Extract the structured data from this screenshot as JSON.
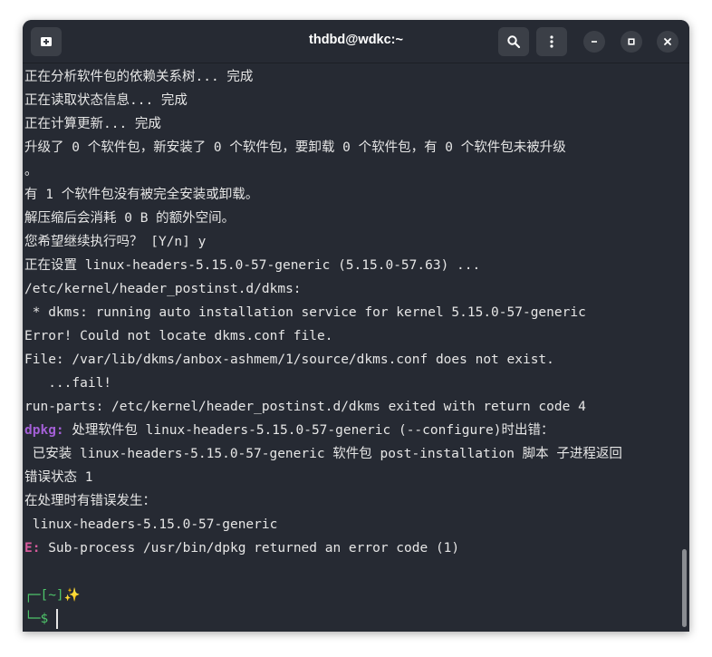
{
  "window": {
    "title": "thdbd@wdkc:~"
  },
  "terminal": {
    "lines": [
      "正在分析软件包的依赖关系树... 完成",
      "正在读取状态信息... 完成",
      "正在计算更新... 完成",
      "升级了 0 个软件包，新安装了 0 个软件包，要卸载 0 个软件包，有 0 个软件包未被升级",
      "。",
      "有 1 个软件包没有被完全安装或卸载。",
      "解压缩后会消耗 0 B 的额外空间。",
      "您希望继续执行吗？ [Y/n] y",
      "正在设置 linux-headers-5.15.0-57-generic (5.15.0-57.63) ...",
      "/etc/kernel/header_postinst.d/dkms:",
      " * dkms: running auto installation service for kernel 5.15.0-57-generic",
      "Error! Could not locate dkms.conf file.",
      "File: /var/lib/dkms/anbox-ashmem/1/source/dkms.conf does not exist.",
      "   ...fail!",
      "run-parts: /etc/kernel/header_postinst.d/dkms exited with return code 4"
    ],
    "dpkg_prefix": "dpkg:",
    "dpkg_msg": " 处理软件包 linux-headers-5.15.0-57-generic (--configure)时出错：",
    "lines2": [
      " 已安装 linux-headers-5.15.0-57-generic 软件包 post-installation 脚本 子进程返回",
      "错误状态 1",
      "在处理时有错误发生：",
      " linux-headers-5.15.0-57-generic"
    ],
    "err_prefix": "E:",
    "err_msg": " Sub-process /usr/bin/dpkg returned an error code (1)",
    "prompt_top_branch": "┌─",
    "prompt_dir": "[~]",
    "prompt_sparkle": "✨",
    "prompt_bottom_branch": "└─",
    "prompt_symbol": "$"
  },
  "colors": {
    "background": "#262a33",
    "text": "#e6e6e6",
    "dpkg": "#a35fd6",
    "error": "#d65b9c",
    "prompt": "#4ec46a"
  },
  "icons": {
    "new_tab": "new-tab-icon",
    "search": "search-icon",
    "menu": "kebab-menu-icon",
    "minimize": "minimize-icon",
    "maximize": "maximize-icon",
    "close": "close-icon"
  }
}
